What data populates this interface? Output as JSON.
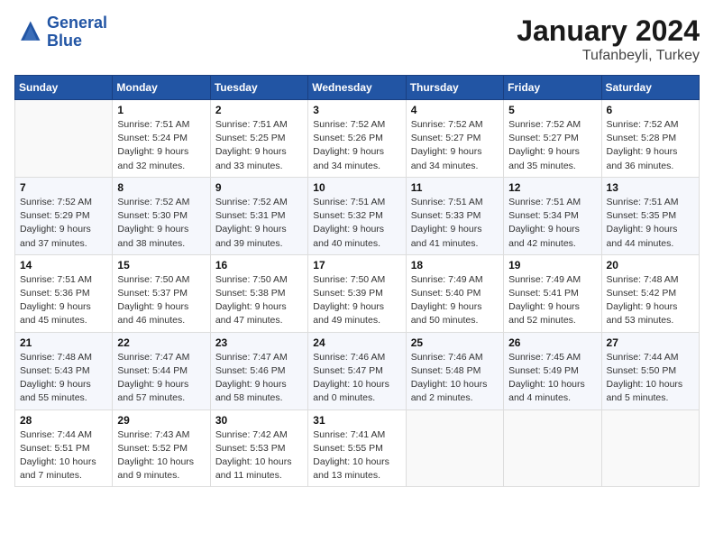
{
  "header": {
    "logo_line1": "General",
    "logo_line2": "Blue",
    "month_title": "January 2024",
    "location": "Tufanbeyli, Turkey"
  },
  "weekdays": [
    "Sunday",
    "Monday",
    "Tuesday",
    "Wednesday",
    "Thursday",
    "Friday",
    "Saturday"
  ],
  "weeks": [
    [
      {
        "day": "",
        "info": ""
      },
      {
        "day": "1",
        "info": "Sunrise: 7:51 AM\nSunset: 5:24 PM\nDaylight: 9 hours\nand 32 minutes."
      },
      {
        "day": "2",
        "info": "Sunrise: 7:51 AM\nSunset: 5:25 PM\nDaylight: 9 hours\nand 33 minutes."
      },
      {
        "day": "3",
        "info": "Sunrise: 7:52 AM\nSunset: 5:26 PM\nDaylight: 9 hours\nand 34 minutes."
      },
      {
        "day": "4",
        "info": "Sunrise: 7:52 AM\nSunset: 5:27 PM\nDaylight: 9 hours\nand 34 minutes."
      },
      {
        "day": "5",
        "info": "Sunrise: 7:52 AM\nSunset: 5:27 PM\nDaylight: 9 hours\nand 35 minutes."
      },
      {
        "day": "6",
        "info": "Sunrise: 7:52 AM\nSunset: 5:28 PM\nDaylight: 9 hours\nand 36 minutes."
      }
    ],
    [
      {
        "day": "7",
        "info": "Sunrise: 7:52 AM\nSunset: 5:29 PM\nDaylight: 9 hours\nand 37 minutes."
      },
      {
        "day": "8",
        "info": "Sunrise: 7:52 AM\nSunset: 5:30 PM\nDaylight: 9 hours\nand 38 minutes."
      },
      {
        "day": "9",
        "info": "Sunrise: 7:52 AM\nSunset: 5:31 PM\nDaylight: 9 hours\nand 39 minutes."
      },
      {
        "day": "10",
        "info": "Sunrise: 7:51 AM\nSunset: 5:32 PM\nDaylight: 9 hours\nand 40 minutes."
      },
      {
        "day": "11",
        "info": "Sunrise: 7:51 AM\nSunset: 5:33 PM\nDaylight: 9 hours\nand 41 minutes."
      },
      {
        "day": "12",
        "info": "Sunrise: 7:51 AM\nSunset: 5:34 PM\nDaylight: 9 hours\nand 42 minutes."
      },
      {
        "day": "13",
        "info": "Sunrise: 7:51 AM\nSunset: 5:35 PM\nDaylight: 9 hours\nand 44 minutes."
      }
    ],
    [
      {
        "day": "14",
        "info": "Sunrise: 7:51 AM\nSunset: 5:36 PM\nDaylight: 9 hours\nand 45 minutes."
      },
      {
        "day": "15",
        "info": "Sunrise: 7:50 AM\nSunset: 5:37 PM\nDaylight: 9 hours\nand 46 minutes."
      },
      {
        "day": "16",
        "info": "Sunrise: 7:50 AM\nSunset: 5:38 PM\nDaylight: 9 hours\nand 47 minutes."
      },
      {
        "day": "17",
        "info": "Sunrise: 7:50 AM\nSunset: 5:39 PM\nDaylight: 9 hours\nand 49 minutes."
      },
      {
        "day": "18",
        "info": "Sunrise: 7:49 AM\nSunset: 5:40 PM\nDaylight: 9 hours\nand 50 minutes."
      },
      {
        "day": "19",
        "info": "Sunrise: 7:49 AM\nSunset: 5:41 PM\nDaylight: 9 hours\nand 52 minutes."
      },
      {
        "day": "20",
        "info": "Sunrise: 7:48 AM\nSunset: 5:42 PM\nDaylight: 9 hours\nand 53 minutes."
      }
    ],
    [
      {
        "day": "21",
        "info": "Sunrise: 7:48 AM\nSunset: 5:43 PM\nDaylight: 9 hours\nand 55 minutes."
      },
      {
        "day": "22",
        "info": "Sunrise: 7:47 AM\nSunset: 5:44 PM\nDaylight: 9 hours\nand 57 minutes."
      },
      {
        "day": "23",
        "info": "Sunrise: 7:47 AM\nSunset: 5:46 PM\nDaylight: 9 hours\nand 58 minutes."
      },
      {
        "day": "24",
        "info": "Sunrise: 7:46 AM\nSunset: 5:47 PM\nDaylight: 10 hours\nand 0 minutes."
      },
      {
        "day": "25",
        "info": "Sunrise: 7:46 AM\nSunset: 5:48 PM\nDaylight: 10 hours\nand 2 minutes."
      },
      {
        "day": "26",
        "info": "Sunrise: 7:45 AM\nSunset: 5:49 PM\nDaylight: 10 hours\nand 4 minutes."
      },
      {
        "day": "27",
        "info": "Sunrise: 7:44 AM\nSunset: 5:50 PM\nDaylight: 10 hours\nand 5 minutes."
      }
    ],
    [
      {
        "day": "28",
        "info": "Sunrise: 7:44 AM\nSunset: 5:51 PM\nDaylight: 10 hours\nand 7 minutes."
      },
      {
        "day": "29",
        "info": "Sunrise: 7:43 AM\nSunset: 5:52 PM\nDaylight: 10 hours\nand 9 minutes."
      },
      {
        "day": "30",
        "info": "Sunrise: 7:42 AM\nSunset: 5:53 PM\nDaylight: 10 hours\nand 11 minutes."
      },
      {
        "day": "31",
        "info": "Sunrise: 7:41 AM\nSunset: 5:55 PM\nDaylight: 10 hours\nand 13 minutes."
      },
      {
        "day": "",
        "info": ""
      },
      {
        "day": "",
        "info": ""
      },
      {
        "day": "",
        "info": ""
      }
    ]
  ]
}
